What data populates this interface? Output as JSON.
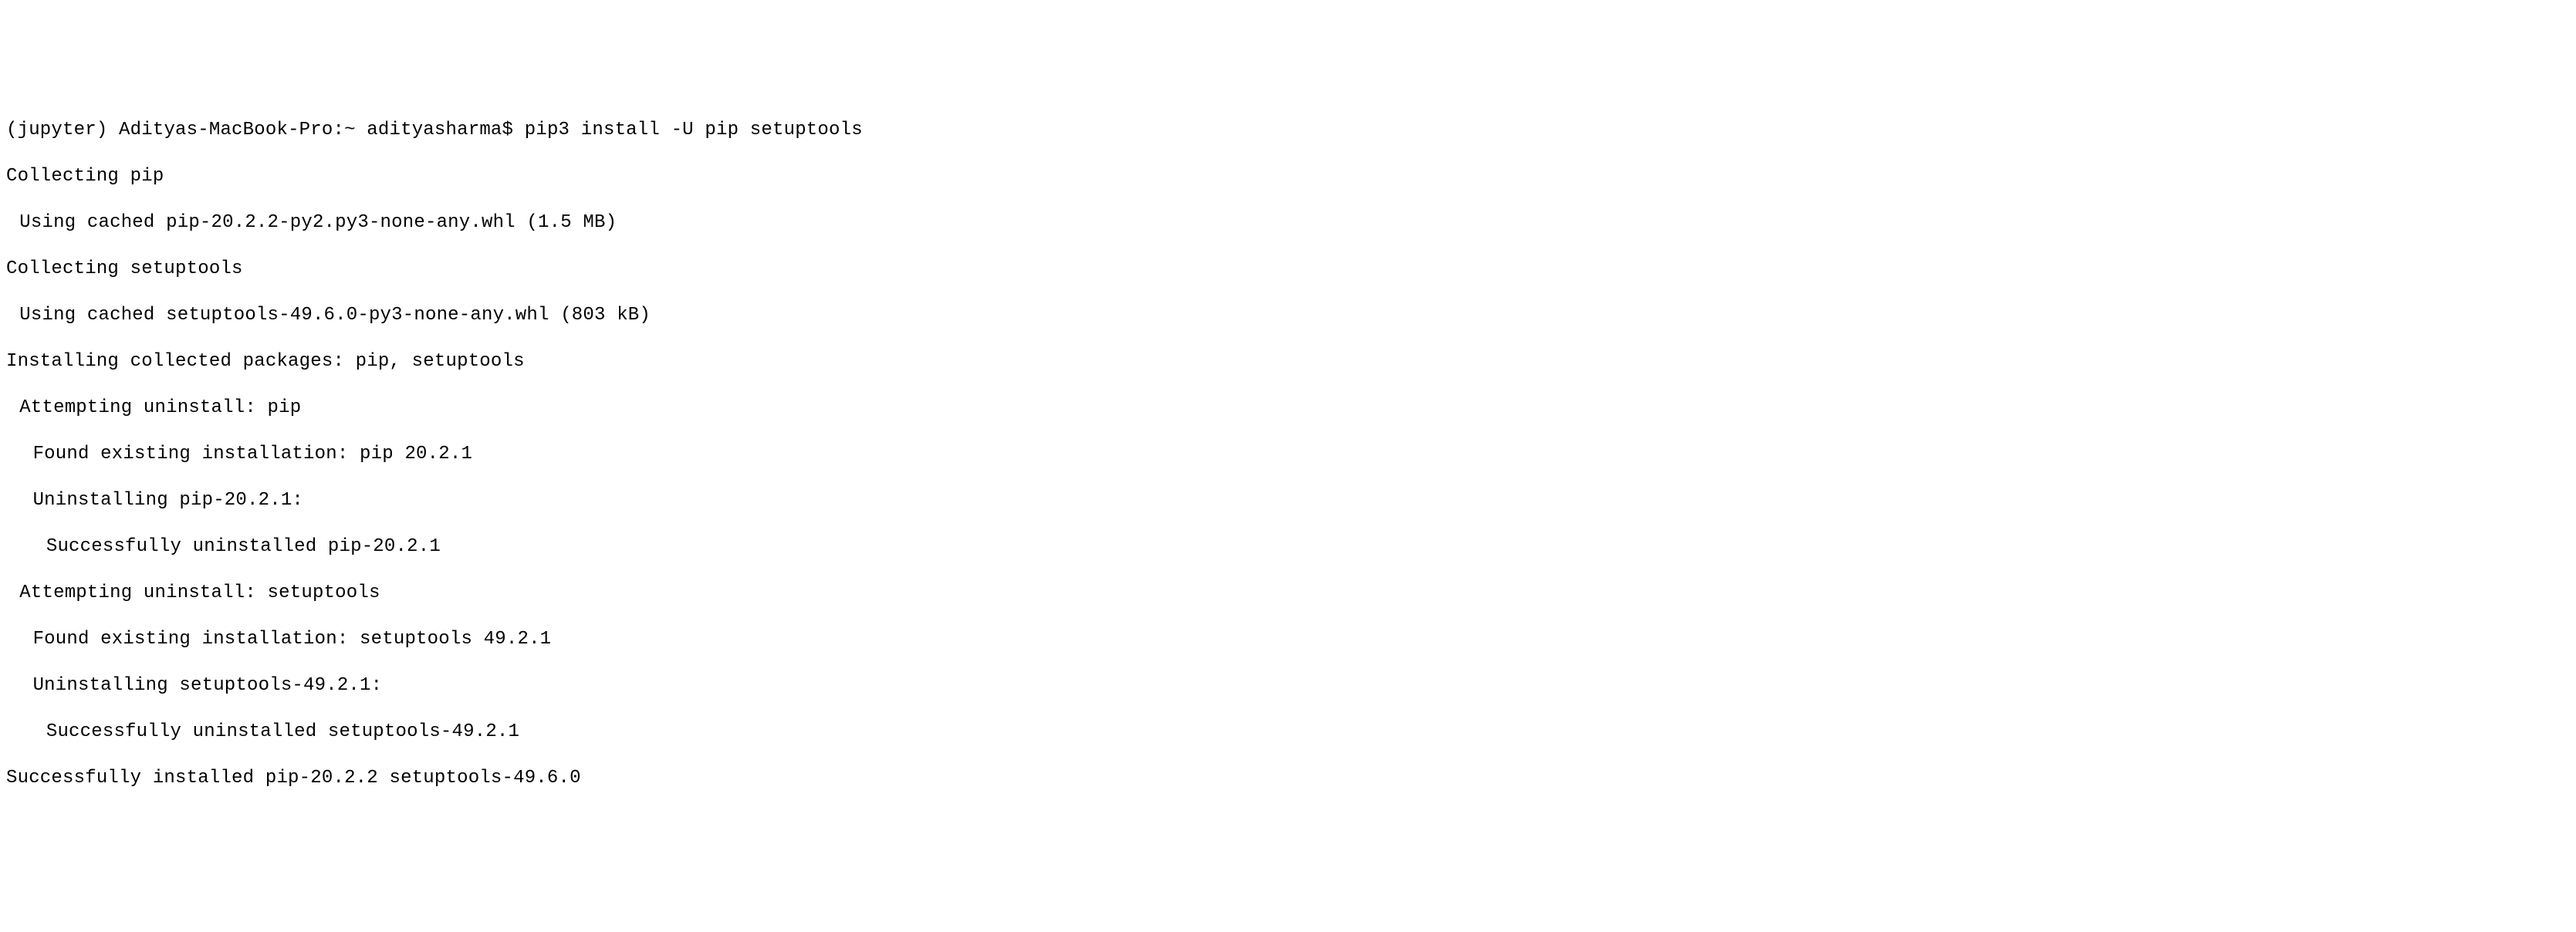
{
  "terminal": {
    "prompt_env": "(jupyter)",
    "prompt_host": "Adityas-MacBook-Pro:~",
    "prompt_user": "adityasharma$",
    "command": "pip3 install -U pip setuptools",
    "lines": {
      "l1": "Collecting pip",
      "l2": "Using cached pip-20.2.2-py2.py3-none-any.whl (1.5 MB)",
      "l3": "Collecting setuptools",
      "l4": "Using cached setuptools-49.6.0-py3-none-any.whl (803 kB)",
      "l5": "Installing collected packages: pip, setuptools",
      "l6": "Attempting uninstall: pip",
      "l7": "Found existing installation: pip 20.2.1",
      "l8": "Uninstalling pip-20.2.1:",
      "l9": "Successfully uninstalled pip-20.2.1",
      "l10": "Attempting uninstall: setuptools",
      "l11": "Found existing installation: setuptools 49.2.1",
      "l12": "Uninstalling setuptools-49.2.1:",
      "l13": "Successfully uninstalled setuptools-49.2.1",
      "l14": "Successfully installed pip-20.2.2 setuptools-49.6.0"
    }
  }
}
